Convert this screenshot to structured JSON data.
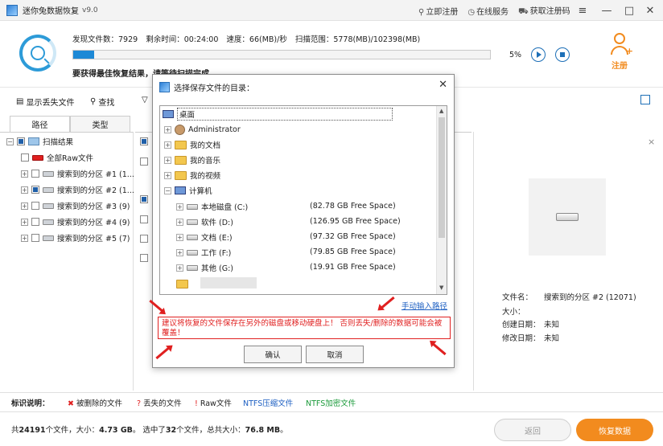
{
  "window": {
    "title": "迷你兔数据恢复",
    "version": "v9.0"
  },
  "title_links": [
    {
      "icon": "search-icon",
      "label": "立即注册"
    },
    {
      "icon": "clock-icon",
      "label": "在线服务"
    },
    {
      "icon": "cart-icon",
      "label": "获取注册码"
    }
  ],
  "scan": {
    "found_label": "发现文件数：",
    "found": "7929",
    "remain_label": "剩余时间：",
    "remain": "00:24:00",
    "speed_label": "速度：",
    "speed": "66(MB)/秒",
    "range_label": "扫描范围：",
    "range": "5778(MB)/102398(MB)",
    "progress": 0.05,
    "percent": "5%",
    "hint": "要获得最佳恢复结果，请等待扫描完成。"
  },
  "register": {
    "label": "注册"
  },
  "toolbar": {
    "show_lost": "显示丢失文件",
    "search": "查找"
  },
  "tabs": [
    "路径",
    "类型"
  ],
  "tree": {
    "root": "扫描结果",
    "items": [
      "全部Raw文件",
      "搜索到的分区 #1 (1...",
      "搜索到的分区 #2 (1...",
      "搜索到的分区 #3 (9)",
      "搜索到的分区 #4 (9)",
      "搜索到的分区 #5 (7)"
    ]
  },
  "info": {
    "name_label": "文件名：",
    "name": "搜索到的分区 #2 (12071)",
    "size_label": "大小：",
    "size": "",
    "created_label": "创建日期：",
    "created": "未知",
    "modified_label": "修改日期：",
    "modified": "未知"
  },
  "legend": {
    "label": "标识说明：",
    "deleted": "被删除的文件",
    "lost": "丢失的文件",
    "raw": "Raw文件",
    "ntfs_comp": "NTFS压缩文件",
    "ntfs_enc": "NTFS加密文件",
    "colors": {
      "deleted": "#e02020",
      "lost": "#e02020",
      "raw": "#e02020",
      "ntfs_comp": "#1d5fc2",
      "ntfs_enc": "#1a9a3a"
    }
  },
  "status": {
    "total_prefix": "共",
    "total_count": "24191",
    "total_mid": "个文件，大小：",
    "total_size": "4.73 GB",
    "sel_prefix": "。 选中了",
    "sel_count": "32",
    "sel_mid": "个文件，总共大小：",
    "sel_size": "76.8 MB",
    "sel_end": "。",
    "back": "返回",
    "recover": "恢复数据"
  },
  "dialog": {
    "title": "选择保存文件的目录：",
    "root": "桌面",
    "items": [
      {
        "label": "Administrator",
        "icon": "person-icon"
      },
      {
        "label": "我的文档",
        "icon": "folder-icon"
      },
      {
        "label": "我的音乐",
        "icon": "folder-icon"
      },
      {
        "label": "我的视频",
        "icon": "folder-icon"
      },
      {
        "label": "计算机",
        "icon": "computer-icon"
      }
    ],
    "drives": [
      {
        "label": "本地磁盘 (C:)",
        "free": "(82.78 GB Free Space)"
      },
      {
        "label": "软件 (D:)",
        "free": "(126.95 GB Free Space)"
      },
      {
        "label": "文档 (E:)",
        "free": "(97.32 GB Free Space)"
      },
      {
        "label": "工作 (F:)",
        "free": "(79.85 GB Free Space)"
      },
      {
        "label": "其他 (G:)",
        "free": "(19.91 GB Free Space)"
      }
    ],
    "manual": "手动输入路径",
    "warning": "建议将恢复的文件保存在另外的磁盘或移动硬盘上！ 否则丢失/删除的数据可能会被覆盖！",
    "ok": "确认",
    "cancel": "取消"
  }
}
